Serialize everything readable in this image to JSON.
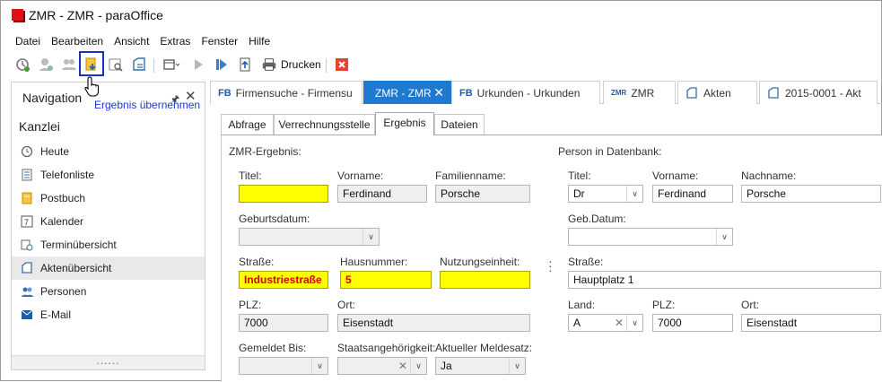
{
  "window": {
    "title": "ZMR - ZMR - paraOffice"
  },
  "menu": [
    "Datei",
    "Bearbeiten",
    "Ansicht",
    "Extras",
    "Fenster",
    "Hilfe"
  ],
  "toolbar": {
    "print_label": "Drucken",
    "tooltip": "Ergebnis übernehmen"
  },
  "nav": {
    "title": "Navigation",
    "group": "Kanzlei",
    "items": [
      "Heute",
      "Telefonliste",
      "Postbuch",
      "Kalender",
      "Terminübersicht",
      "Aktenübersicht",
      "Personen",
      "E-Mail"
    ],
    "active_index": 5,
    "grip": "......"
  },
  "doc_tabs": [
    {
      "prefix": "FB",
      "label": "Firmensuche - Firmensu"
    },
    {
      "prefix": "",
      "label": "ZMR - ZMR"
    },
    {
      "prefix": "FB",
      "label": "Urkunden - Urkunden"
    },
    {
      "prefix": "ZMR",
      "label": "ZMR"
    },
    {
      "prefix": "",
      "label": "Akten"
    },
    {
      "prefix": "",
      "label": "2015-0001 - Akt"
    }
  ],
  "sub_tabs": [
    "Abfrage",
    "Verrechnungsstelle",
    "Ergebnis",
    "Dateien"
  ],
  "zmr": {
    "heading": "ZMR-Ergebnis:",
    "labels": {
      "titel": "Titel:",
      "vorname": "Vorname:",
      "familienname": "Familienname:",
      "geburtsdatum": "Geburtsdatum:",
      "strasse": "Straße:",
      "hausnummer": "Hausnummer:",
      "nutzungseinheit": "Nutzungseinheit:",
      "plz": "PLZ:",
      "ort": "Ort:",
      "gemeldet_bis": "Gemeldet Bis:",
      "staatsangehoerigkeit": "Staatsangehörigkeit:",
      "meldesatz": "Aktueller Meldesatz:"
    },
    "values": {
      "titel": "",
      "vorname": "Ferdinand",
      "familienname": "Porsche",
      "geburtsdatum": "",
      "strasse": "Industriestraße",
      "hausnummer": "5",
      "nutzungseinheit": "",
      "plz": "7000",
      "ort": "Eisenstadt",
      "gemeldet_bis": "",
      "staatsangehoerigkeit": "",
      "meldesatz": "Ja"
    }
  },
  "db": {
    "heading": "Person in Datenbank:",
    "labels": {
      "titel": "Titel:",
      "vorname": "Vorname:",
      "nachname": "Nachname:",
      "geb_datum": "Geb.Datum:",
      "strasse": "Straße:",
      "land": "Land:",
      "plz": "PLZ:",
      "ort": "Ort:"
    },
    "values": {
      "titel": "Dr",
      "vorname": "Ferdinand",
      "nachname": "Porsche",
      "geb_datum": "",
      "strasse": "Hauptplatz 1",
      "land": "A",
      "plz": "7000",
      "ort": "Eisenstadt"
    }
  },
  "colors": {
    "accent": "#1e7ad1",
    "highlight": "#ffff00",
    "changed_text": "#d40000",
    "tooltip": "#1f36d6"
  }
}
